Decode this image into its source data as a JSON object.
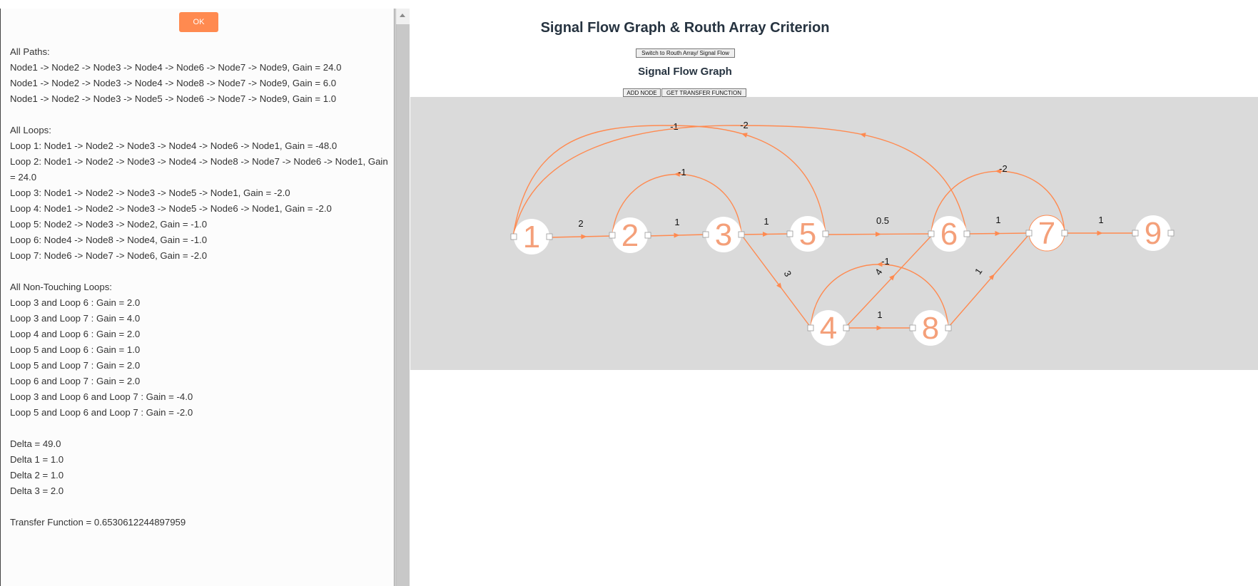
{
  "ok_button": "OK",
  "results": {
    "paths_header": "All Paths:",
    "paths": [
      "Node1 -> Node2 -> Node3 -> Node4 -> Node6 -> Node7 -> Node9, Gain = 24.0",
      "Node1 -> Node2 -> Node3 -> Node4 -> Node8 -> Node7 -> Node9, Gain = 6.0",
      "Node1 -> Node2 -> Node3 -> Node5 -> Node6 -> Node7 -> Node9, Gain = 1.0"
    ],
    "loops_header": "All Loops:",
    "loops": [
      "Loop 1: Node1 -> Node2 -> Node3 -> Node4 -> Node6 -> Node1, Gain = -48.0",
      "Loop 2: Node1 -> Node2 -> Node3 -> Node4 -> Node8 -> Node7 -> Node6 -> Node1, Gain = 24.0",
      "Loop 3: Node1 -> Node2 -> Node3 -> Node5 -> Node1, Gain = -2.0",
      "Loop 4: Node1 -> Node2 -> Node3 -> Node5 -> Node6 -> Node1, Gain = -2.0",
      "Loop 5: Node2 -> Node3 -> Node2, Gain = -1.0",
      "Loop 6: Node4 -> Node8 -> Node4, Gain = -1.0",
      "Loop 7: Node6 -> Node7 -> Node6, Gain = -2.0"
    ],
    "nontouching_header": "All Non-Touching Loops:",
    "nontouching": [
      "Loop 3 and Loop 6 : Gain = 2.0",
      "Loop 3 and Loop 7 : Gain = 4.0",
      "Loop 4 and Loop 6 : Gain = 2.0",
      "Loop 5 and Loop 6 : Gain = 1.0",
      "Loop 5 and Loop 7 : Gain = 2.0",
      "Loop 6 and Loop 7 : Gain = 2.0",
      "Loop 3 and Loop 6 and Loop 7 : Gain = -4.0",
      "Loop 5 and Loop 6 and Loop 7 : Gain = -2.0"
    ],
    "deltas": [
      "Delta = 49.0",
      "Delta 1 = 1.0",
      "Delta 2 = 1.0",
      "Delta 3 = 2.0"
    ],
    "transfer_function": "Transfer Function = 0.6530612244897959"
  },
  "header": {
    "title": "Signal Flow Graph & Routh Array Criterion",
    "switch_button": "Switch to Routh Array/ Signal Flow",
    "section_title": "Signal Flow Graph",
    "add_node_button": "ADD NODE",
    "transfer_button": "GET TRANSFER FUNCTION"
  },
  "graph": {
    "colors": {
      "edge": "#ff8a50",
      "node_fill": "#ffffff",
      "node_label": "#f4a07a",
      "canvas": "#dadada"
    },
    "nodes": [
      {
        "id": 1,
        "label": "1"
      },
      {
        "id": 2,
        "label": "2"
      },
      {
        "id": 3,
        "label": "3"
      },
      {
        "id": 5,
        "label": "5"
      },
      {
        "id": 6,
        "label": "6"
      },
      {
        "id": 7,
        "label": "7"
      },
      {
        "id": 9,
        "label": "9"
      },
      {
        "id": 4,
        "label": "4"
      },
      {
        "id": 8,
        "label": "8"
      }
    ],
    "edges": [
      {
        "from": 1,
        "to": 2,
        "gain": "2"
      },
      {
        "from": 2,
        "to": 3,
        "gain": "1"
      },
      {
        "from": 3,
        "to": 5,
        "gain": "1"
      },
      {
        "from": 5,
        "to": 6,
        "gain": "0.5"
      },
      {
        "from": 6,
        "to": 7,
        "gain": "1"
      },
      {
        "from": 7,
        "to": 9,
        "gain": "1"
      },
      {
        "from": 3,
        "to": 4,
        "gain": "3"
      },
      {
        "from": 4,
        "to": 8,
        "gain": "1"
      },
      {
        "from": 4,
        "to": 6,
        "gain": "4"
      },
      {
        "from": 8,
        "to": 7,
        "gain": "1"
      },
      {
        "from": 5,
        "to": 1,
        "gain": "-1"
      },
      {
        "from": 6,
        "to": 1,
        "gain": "-2"
      },
      {
        "from": 3,
        "to": 2,
        "gain": "-1"
      },
      {
        "from": 8,
        "to": 4,
        "gain": "-1"
      },
      {
        "from": 7,
        "to": 6,
        "gain": "-2"
      }
    ]
  }
}
